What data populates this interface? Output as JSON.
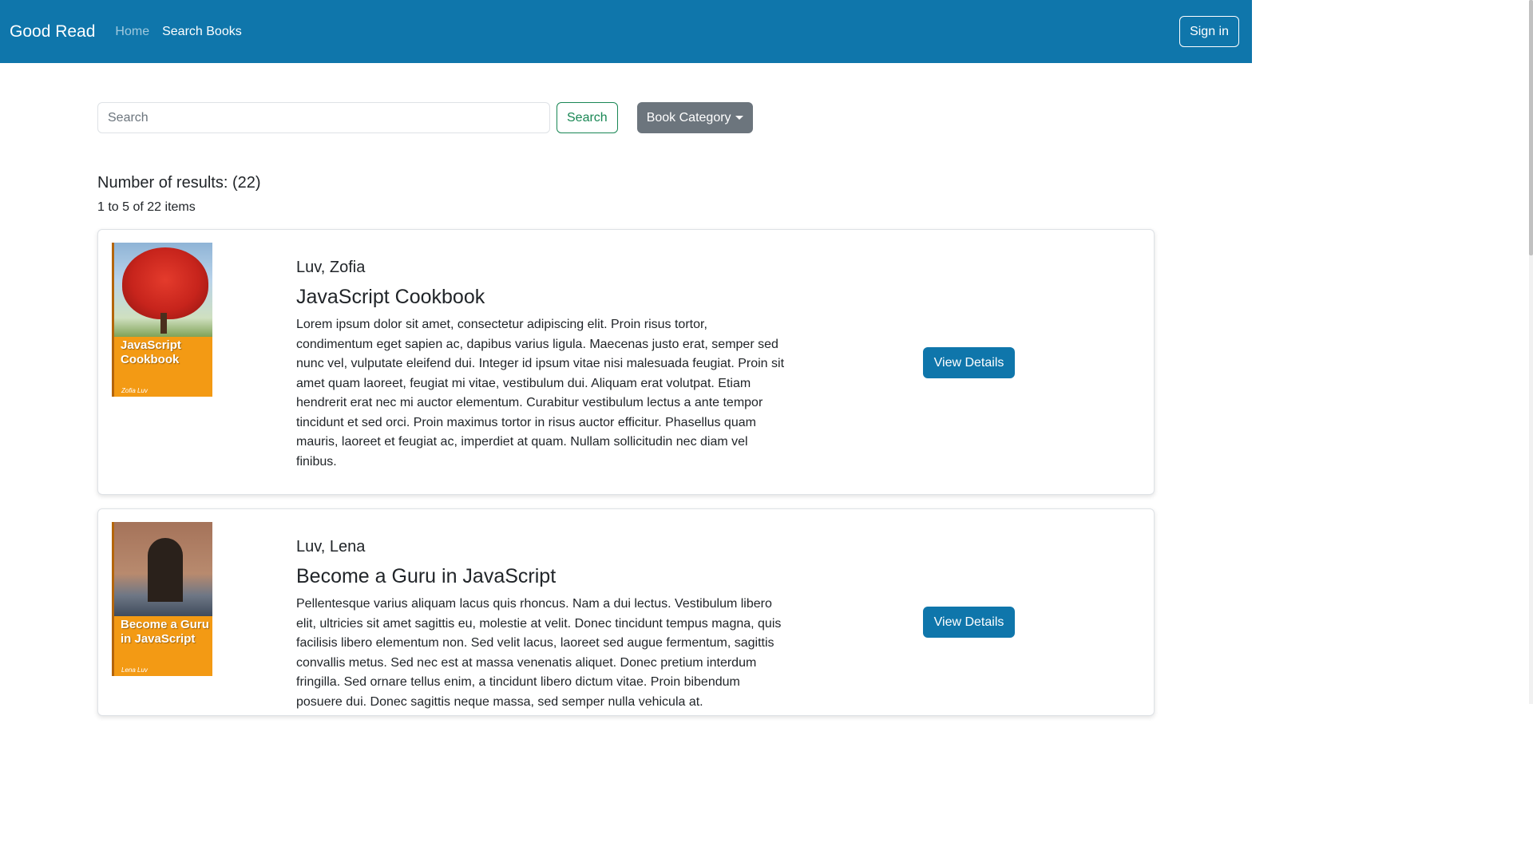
{
  "navbar": {
    "brand": "Good Read",
    "links": [
      {
        "label": "Home"
      },
      {
        "label": "Search Books"
      }
    ],
    "sign_in_label": "Sign in"
  },
  "search": {
    "placeholder": "Search",
    "button_label": "Search",
    "category_label": "Book Category"
  },
  "results": {
    "count_text": "Number of results: (22)",
    "range_text": "1 to 5 of 22 items"
  },
  "books": [
    {
      "author": "Luv, Zofia",
      "title": "JavaScript Cookbook",
      "description": "Lorem ipsum dolor sit amet, consectetur adipiscing elit. Proin risus tortor, condimentum eget sapien ac, dapibus varius ligula. Maecenas justo erat, semper sed nunc vel, vulputate eleifend dui. Integer id ipsum vitae nisi malesuada feugiat. Proin sit amet quam laoreet, feugiat mi vitae, vestibulum dui. Aliquam erat volutpat. Etiam hendrerit erat nec mi auctor elementum. Curabitur vestibulum lectus a ante tempor tincidunt et sed orci. Proin maximus tortor in risus auctor efficitur. Phasellus quam mauris, laoreet et feugiat ac, imperdiet at quam. Nullam sollicitudin nec diam vel finibus.",
      "cover_title": "JavaScript Cookbook",
      "cover_author": "Zofia Luv",
      "details_label": "View Details"
    },
    {
      "author": "Luv, Lena",
      "title": "Become a Guru in JavaScript",
      "description": "Pellentesque varius aliquam lacus quis rhoncus. Nam a dui lectus. Vestibulum libero elit, ultricies sit amet sagittis eu, molestie at velit. Donec tincidunt tempus magna, quis facilisis libero elementum non. Sed velit lacus, laoreet sed augue fermentum, sagittis convallis metus. Sed nec est at massa venenatis aliquet. Donec pretium interdum fringilla. Sed ornare tellus enim, a tincidunt libero dictum vitae. Proin bibendum posuere dui. Donec sagittis neque massa, sed semper nulla vehicula at.",
      "cover_title": "Become a Guru in JavaScript",
      "cover_author": "Lena Luv",
      "details_label": "View Details"
    }
  ],
  "colors": {
    "navbar_bg": "#0f76ab",
    "primary_button": "#0f76ab",
    "search_button_outline": "#198754",
    "category_button": "#6c757d",
    "cover_orange": "#f39a14"
  }
}
